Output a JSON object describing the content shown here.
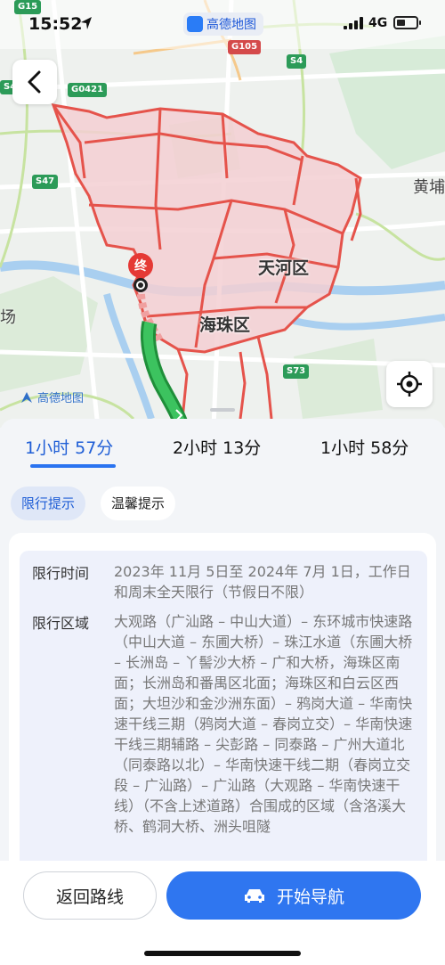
{
  "status": {
    "time": "15:52",
    "app_label": "高德地图",
    "network": "4G"
  },
  "map": {
    "road_tags": [
      "G15",
      "G105",
      "S4",
      "G0421",
      "S4",
      "S47",
      "S73"
    ],
    "districts": [
      "天河区",
      "海珠区"
    ],
    "edge_labels": [
      "黄埔",
      "场"
    ],
    "end_marker": "终",
    "logo_text": "高德地图",
    "restriction_color": "#e5534b",
    "route_color": "#2fb34f"
  },
  "routes": [
    {
      "label": "1小时 57分",
      "active": true
    },
    {
      "label": "2小时 13分",
      "active": false
    },
    {
      "label": "1小时 58分",
      "active": false
    }
  ],
  "tips": {
    "active": "限行提示",
    "other": "温馨提示"
  },
  "restriction": {
    "time_label": "限行时间",
    "time_value": "2023年 11月 5日至 2024年 7月 1日，工作日和周末全天限行（节假日不限）",
    "area_label": "限行区域",
    "area_value": "大观路（广汕路 – 中山大道）– 东环城市快速路（中山大道 – 东圃大桥）– 珠江水道（东圃大桥 – 长洲岛 – 丫髻沙大桥 – 广和大桥，海珠区南面；长洲岛和番禺区北面；海珠区和白云区西面；大坦沙和金沙洲东面）– 鸦岗大道 – 华南快速干线三期（鸦岗大道 – 春岗立交）– 华南快速干线三期辅路 – 尖彭路 – 同泰路 – 广州大道北（同泰路以北）– 华南快速干线二期（春岗立交段 – 广汕路）– 广汕路（大观路 – 华南快速干线）（不含上述道路）合围成的区域（含洛溪大桥、鹤洞大桥、洲头咀隧"
  },
  "actions": {
    "back_label": "返回路线",
    "start_label": "开始导航"
  }
}
